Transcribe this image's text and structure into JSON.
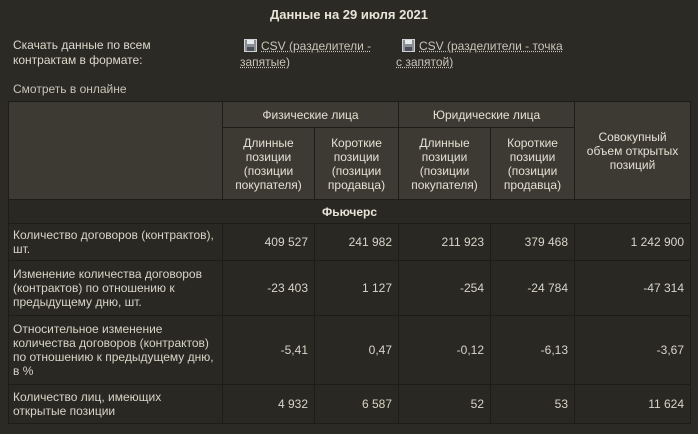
{
  "title": "Данные на 29 июля 2021",
  "download": {
    "label": "Скачать данные по всем контрактам в формате:",
    "links": [
      {
        "icon": "floppy-disk-icon",
        "line1": "CSV (разделители -",
        "line2": "запятые)"
      },
      {
        "icon": "floppy-disk-icon",
        "line1": "CSV (разделители - точка",
        "line2": "с запятой)"
      }
    ]
  },
  "online_link": "Смотреть в онлайне",
  "table": {
    "group_headers": {
      "individuals": "Физические лица",
      "legal": "Юридические лица",
      "total": "Совокупный объем открытых позиций"
    },
    "sub_headers": {
      "long": "Длинные позиции (позиции покупателя)",
      "short": "Короткие позиции (позиции продавца)"
    },
    "section": "Фьючерс",
    "rows": [
      {
        "label": "Количество договоров (контрактов), шт.",
        "values": [
          "409 527",
          "241 982",
          "211 923",
          "379 468",
          "1 242 900"
        ]
      },
      {
        "label": "Изменение количества договоров (контрактов) по отношению к предыдущему дню, шт.",
        "values": [
          "-23 403",
          "1 127",
          "-254",
          "-24 784",
          "-47 314"
        ]
      },
      {
        "label": "Относительное изменение количества договоров (контрактов) по отношению к предыдущему дню, в %",
        "values": [
          "-5,41",
          "0,47",
          "-0,12",
          "-6,13",
          "-3,67"
        ]
      },
      {
        "label": "Количество лиц, имеющих открытые позиции",
        "values": [
          "4 932",
          "6 587",
          "52",
          "53",
          "11 624"
        ]
      }
    ]
  },
  "colors": {
    "background": "#2c2a25",
    "header_bg": "#3d3a33",
    "text": "#dcd8cc"
  }
}
